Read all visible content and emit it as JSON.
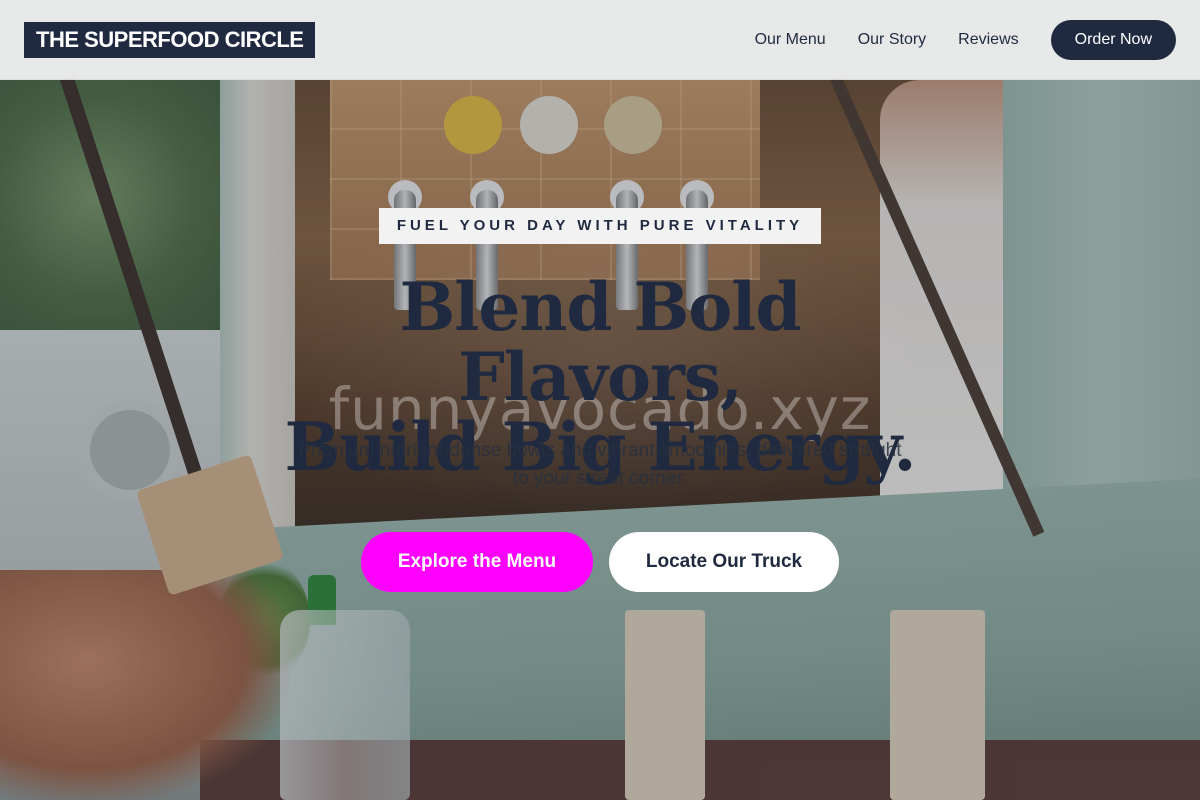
{
  "header": {
    "logo_text": "THE SUPERFOOD CIRCLE",
    "nav": [
      {
        "label": "Our Menu"
      },
      {
        "label": "Our Story"
      },
      {
        "label": "Reviews"
      }
    ],
    "cta_label": "Order Now"
  },
  "hero": {
    "eyebrow": "FUEL YOUR DAY WITH PURE VITALITY",
    "headline_line1": "Blend Bold Flavors,",
    "headline_line2": "Build Big Energy.",
    "watermark": "funnyavocado.xyz",
    "subtext": "Premium nutrient-dense bowls and vibrant smoothies, delivered straight to your street corner.",
    "primary_cta": "Explore the Menu",
    "secondary_cta": "Locate Our Truck",
    "background_image": "food-truck-counter-photo"
  },
  "colors": {
    "brand_dark": "#1f2a40",
    "accent_magenta": "#ff00ff",
    "header_bg": "#f2f2f2"
  }
}
